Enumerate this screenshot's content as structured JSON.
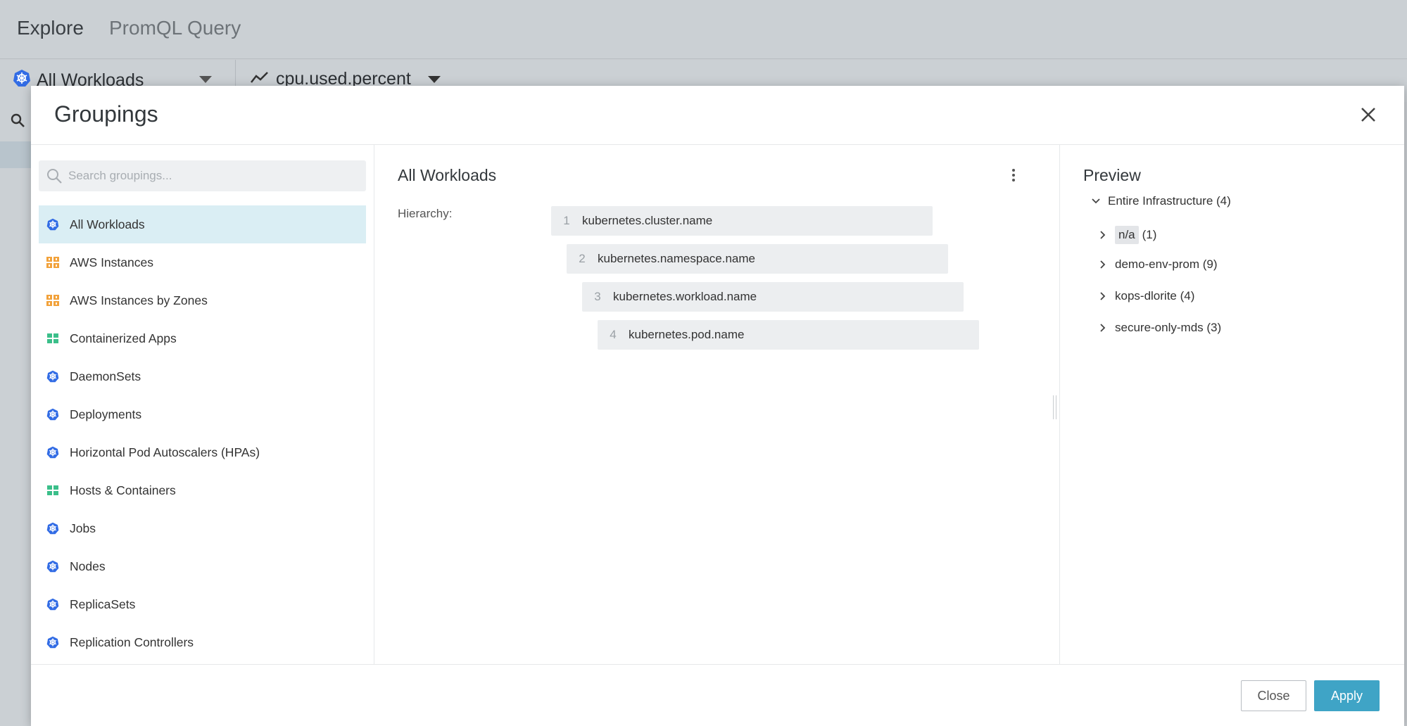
{
  "background": {
    "tabs": [
      {
        "label": "Explore"
      },
      {
        "label": "PromQL Query"
      }
    ],
    "scope_label": "All Workloads",
    "metric_label": "cpu.used.percent"
  },
  "modal": {
    "title": "Groupings",
    "search_placeholder": "Search groupings...",
    "groupings": [
      {
        "label": "All Workloads",
        "icon": "kubernetes-icon",
        "selected": true
      },
      {
        "label": "AWS Instances",
        "icon": "aws-icon"
      },
      {
        "label": "AWS Instances by Zones",
        "icon": "aws-icon"
      },
      {
        "label": "Containerized Apps",
        "icon": "container-icon"
      },
      {
        "label": "DaemonSets",
        "icon": "kubernetes-icon"
      },
      {
        "label": "Deployments",
        "icon": "kubernetes-icon"
      },
      {
        "label": "Horizontal Pod Autoscalers (HPAs)",
        "icon": "kubernetes-icon"
      },
      {
        "label": "Hosts & Containers",
        "icon": "container-icon"
      },
      {
        "label": "Jobs",
        "icon": "kubernetes-icon"
      },
      {
        "label": "Nodes",
        "icon": "kubernetes-icon"
      },
      {
        "label": "ReplicaSets",
        "icon": "kubernetes-icon"
      },
      {
        "label": "Replication Controllers",
        "icon": "kubernetes-icon"
      }
    ],
    "detail": {
      "title": "All Workloads",
      "hierarchy_label": "Hierarchy:",
      "hierarchy": [
        {
          "num": "1",
          "label": "kubernetes.cluster.name"
        },
        {
          "num": "2",
          "label": "kubernetes.namespace.name"
        },
        {
          "num": "3",
          "label": "kubernetes.workload.name"
        },
        {
          "num": "4",
          "label": "kubernetes.pod.name"
        }
      ]
    },
    "preview": {
      "title": "Preview",
      "root": "Entire Infrastructure (4)",
      "children": [
        {
          "tag": "n/a",
          "count": "(1)"
        },
        {
          "label": "demo-env-prom (9)"
        },
        {
          "label": "kops-dlorite (4)"
        },
        {
          "label": "secure-only-mds (3)"
        }
      ]
    },
    "buttons": {
      "close": "Close",
      "apply": "Apply"
    },
    "colors": {
      "accent": "#3fa4c6",
      "selected_bg": "#daeef4",
      "kubernetes": "#326ce5",
      "aws": "#f2a23b",
      "container": "#3bbf8a"
    }
  }
}
